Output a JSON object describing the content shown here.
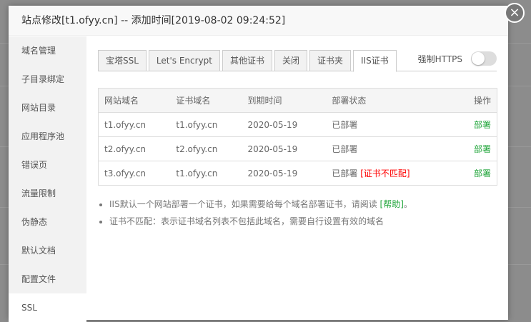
{
  "header": {
    "title": "站点修改[t1.ofyy.cn] -- 添加时间[2019-08-02 09:24:52]",
    "close": "×"
  },
  "sidebar": {
    "items": [
      "域名管理",
      "子目录绑定",
      "网站目录",
      "应用程序池",
      "错误页",
      "流量限制",
      "伪静态",
      "默认文档",
      "配置文件",
      "SSL"
    ]
  },
  "tabs": [
    "宝塔SSL",
    "Let's Encrypt",
    "其他证书",
    "关闭",
    "证书夹",
    "IIS证书"
  ],
  "force_https": {
    "label": "强制HTTPS",
    "enabled": false
  },
  "table": {
    "headers": [
      "网站域名",
      "证书域名",
      "到期时间",
      "部署状态",
      "操作"
    ],
    "rows": [
      {
        "site": "t1.ofyy.cn",
        "cert": "t1.ofyy.cn",
        "expire": "2020-05-19",
        "status": "已部署",
        "warn": "",
        "action": "部署"
      },
      {
        "site": "t2.ofyy.cn",
        "cert": "t2.ofyy.cn",
        "expire": "2020-05-19",
        "status": "已部署",
        "warn": "",
        "action": "部署"
      },
      {
        "site": "t3.ofyy.cn",
        "cert": "t1.ofyy.cn",
        "expire": "2020-05-19",
        "status": "已部署",
        "warn": "[证书不匹配]",
        "action": "部署"
      }
    ]
  },
  "notes": {
    "n1": "IIS默认一个网站部署一个证书，如果需要给每个域名部署证书，请阅读 ",
    "help": "[帮助]",
    "n1end": "。",
    "n2": "证书不匹配：表示证书域名列表不包括此域名，需要自行设置有效的域名"
  },
  "colors": {
    "accent": "#20a53a",
    "warn": "#ff0000"
  }
}
